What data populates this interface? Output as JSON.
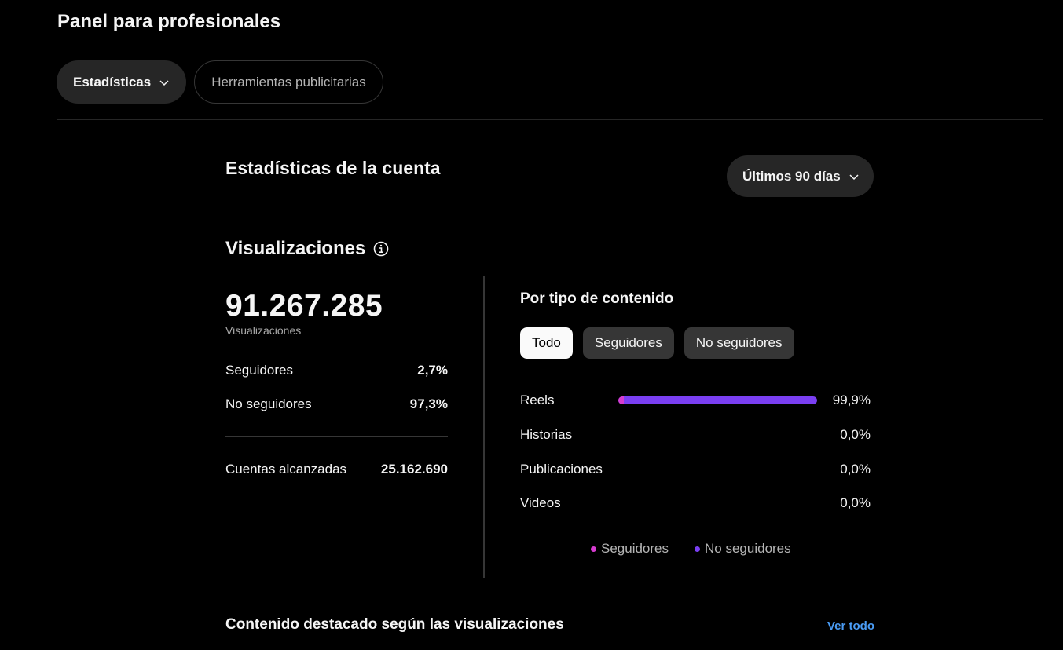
{
  "header": {
    "title": "Panel para profesionales"
  },
  "top_tabs": [
    {
      "label": "Estadísticas",
      "active": true
    },
    {
      "label": "Herramientas publicitarias",
      "active": false
    }
  ],
  "account": {
    "title": "Estadísticas de la cuenta",
    "date_range": "Últimos 90 días"
  },
  "views": {
    "title": "Visualizaciones",
    "total": "91.267.285",
    "total_label": "Visualizaciones",
    "followers_label": "Seguidores",
    "followers_value": "2,7%",
    "non_followers_label": "No seguidores",
    "non_followers_value": "97,3%",
    "reach_label": "Cuentas alcanzadas",
    "reach_value": "25.162.690"
  },
  "content_type": {
    "title": "Por tipo de contenido",
    "filters": [
      "Todo",
      "Seguidores",
      "No seguidores"
    ],
    "active_filter": "Todo",
    "rows": [
      {
        "label": "Reels",
        "value": "99,9%",
        "fraction": 0.999,
        "followers_fraction": 0.027
      },
      {
        "label": "Historias",
        "value": "0,0%",
        "fraction": 0,
        "followers_fraction": 0
      },
      {
        "label": "Publicaciones",
        "value": "0,0%",
        "fraction": 0,
        "followers_fraction": 0
      },
      {
        "label": "Videos",
        "value": "0,0%",
        "fraction": 0,
        "followers_fraction": 0
      }
    ],
    "legend": [
      {
        "label": "Seguidores",
        "color": "#d63ccf"
      },
      {
        "label": "No seguidores",
        "color": "#7a3ff2"
      }
    ]
  },
  "featured": {
    "title": "Contenido destacado según las visualizaciones",
    "see_all": "Ver todo"
  },
  "colors": {
    "background": "#000000",
    "pill_bg": "#262626",
    "link": "#4a9cf5",
    "followers": "#d63ccf",
    "non_followers": "#7a3ff2"
  }
}
